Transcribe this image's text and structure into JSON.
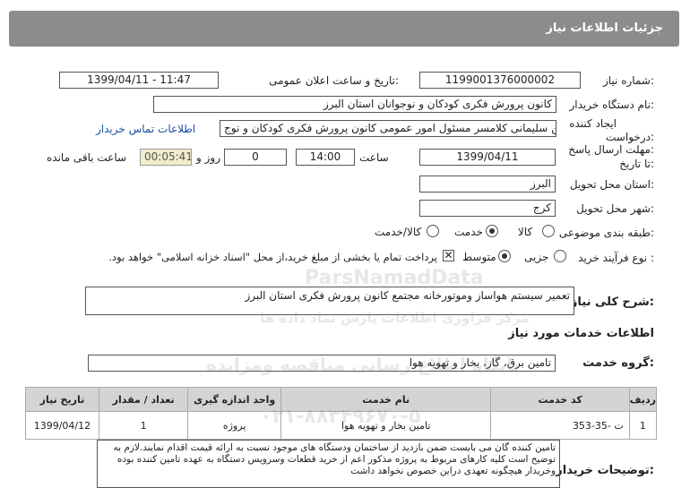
{
  "header": {
    "title": "جزئیات اطلاعات نیاز"
  },
  "fields": {
    "need_number_label": "شماره نیاز:",
    "need_number": "1199001376000002",
    "announce_label": "تاریخ و ساعت اعلان عمومی:",
    "announce_value": "1399/04/11 - 11:47",
    "buyer_label": "نام دستگاه خریدار:",
    "buyer_value": "کانون پرورش فکری کودکان و نوجوانان استان البرز",
    "creator_label_1": "ایجاد کننده",
    "creator_label_2": "درخواست:",
    "creator_value": "حسین سلیمانی کلامسر مسئول امور عمومی کانون پرورش فکری کودکان و نوج",
    "contact_link": "اطلاعات تماس خریدار",
    "deadline_label_1": "مهلت ارسال پاسخ:",
    "deadline_label_2": "تا تاریخ:",
    "deadline_date": "1399/04/11",
    "hour_label": "ساعت",
    "deadline_hour": "14:00",
    "days_value": "0",
    "days_label": "روز و",
    "remaining_time": "00:05:41",
    "remaining_label": "ساعت باقی مانده",
    "province_label": "استان محل تحویل:",
    "province_value": "البرز",
    "city_label": "شهر محل تحویل:",
    "city_value": "کرج",
    "category_label": "طبقه بندی موضوعی:",
    "category_options": [
      "کالا",
      "خدمت",
      "کالا/خدمت"
    ],
    "process_label": "نوع فرآیند خرید :",
    "process_options": [
      "جزیی",
      "متوسط"
    ],
    "payment_note": "پرداخت تمام یا بخشی از مبلغ خرید،از محل \"اسناد خزانه اسلامی\" خواهد بود."
  },
  "summary": {
    "label": "شرح کلی نیاز:",
    "value": "تعمیر سیستم هواساز وموتورخانه مجتمع کانون پرورش فکری استان البرز"
  },
  "services": {
    "title": "اطلاعات خدمات مورد نیاز",
    "group_label": "گروه خدمت:",
    "group_value": "تامین برق، گاز، بخار و تهویه هوا",
    "columns": [
      "ردیف",
      "کد خدمت",
      "نام خدمت",
      "واحد اندازه گیری",
      "تعداد / مقدار",
      "تاریخ نیاز"
    ],
    "rows": [
      [
        "1",
        "ت -35-353",
        "تامین بخار و تهویه هوا",
        "پروژه",
        "1",
        "1399/04/12"
      ]
    ]
  },
  "buyer_notes": {
    "label": "توضیحات خریدار:",
    "text": "تامین کننده گان می بایست ضمن بازدید از ساختمان ودستگاه های موجود نسبت به ارائه قیمت اقدام نمایند.لازم به توضیح است کلیه کارهای مربوط به پروژه مذکور اعم از خرید قطعات وسرویس دستگاه به عهده تامین کننده بوده وخریدار هیچگونه تعهدی دراین خصوص نخواهد داشت"
  },
  "watermark": {
    "brand": "ParsNamadData",
    "line1": "مرکز فراوری اطلاعات پارس نماد داده ها",
    "line2": "پایگاه اطلاع رسانی مناقصه ومزایده",
    "phone": "۰۲۱-۸۸۳۴۹۶۷۰-۵"
  }
}
